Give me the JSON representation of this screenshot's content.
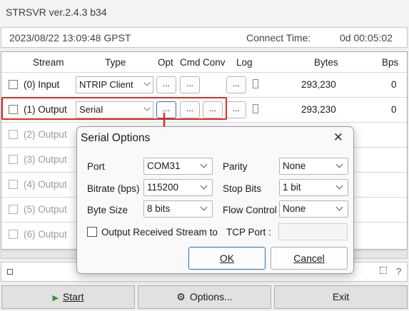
{
  "window": {
    "title": "STRSVR ver.2.4.3 b34"
  },
  "timebar": {
    "datetime": "2023/08/22 13:09:48 GPST",
    "connect_label": "Connect Time:",
    "connect_value": "0d 00:05:02"
  },
  "table": {
    "headers": {
      "stream": "Stream",
      "type": "Type",
      "opt": "Opt",
      "cmd": "Cmd",
      "conv": "Conv",
      "log": "Log",
      "bytes": "Bytes",
      "bps": "Bps"
    },
    "rows": [
      {
        "label": "(0) Input",
        "type": "NTRIP Client",
        "bytes": "293,230",
        "bps": "0"
      },
      {
        "label": "(1) Output",
        "type": "Serial",
        "bytes": "293,230",
        "bps": "0"
      },
      {
        "label": "(2) Output"
      },
      {
        "label": "(3) Output"
      },
      {
        "label": "(4) Output"
      },
      {
        "label": "(5) Output"
      },
      {
        "label": "(6) Output"
      }
    ],
    "ellipsis": "..."
  },
  "dialog": {
    "title": "Serial Options",
    "close": "✕",
    "port_label": "Port",
    "port_value": "COM31",
    "bitrate_label": "Bitrate (bps)",
    "bitrate_value": "115200",
    "bytesize_label": "Byte Size",
    "bytesize_value": "8 bits",
    "parity_label": "Parity",
    "parity_value": "None",
    "stopbits_label": "Stop Bits",
    "stopbits_value": "1 bit",
    "flow_label": "Flow Control",
    "flow_value": "None",
    "output_received_label": "Output Received Stream to",
    "tcp_port_label": "TCP Port :",
    "ok": "OK",
    "cancel": "Cancel"
  },
  "buttons": {
    "start": "Start",
    "options": "Options...",
    "exit": "Exit"
  },
  "statusbar": {
    "help": "?"
  },
  "colors": {
    "highlight": "#e32a22",
    "focus": "#2e6bc4",
    "start_icon": "#2a9a2a"
  }
}
